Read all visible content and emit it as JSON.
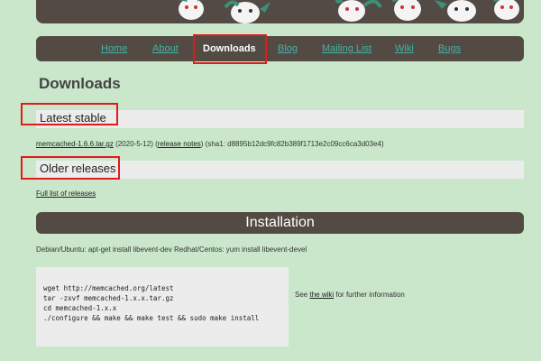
{
  "nav": {
    "items": [
      {
        "label": "Home"
      },
      {
        "label": "About"
      },
      {
        "label": "Downloads"
      },
      {
        "label": "Blog"
      },
      {
        "label": "Mailing List"
      },
      {
        "label": "Wiki"
      },
      {
        "label": "Bugs"
      }
    ],
    "active": "Downloads"
  },
  "page": {
    "title": "Downloads"
  },
  "latest": {
    "heading": "Latest stable",
    "file_link": "memcached-1.6.6.tar.gz",
    "date": "(2020-5-12)",
    "paren_open": " (",
    "notes_link": "release notes",
    "sha": ") (sha1: d8895b12dc9fc82b389f1713e2c09cc6ca3d03e4)"
  },
  "older": {
    "heading": "Older releases",
    "list_link": "Full list of releases"
  },
  "install": {
    "heading": "Installation",
    "pkg_text": "Debian/Ubuntu: apt-get install libevent-dev Redhat/Centos: yum install libevent-devel",
    "code_lines": [
      "wget http://memcached.org/latest",
      "tar -zxvf memcached-1.x.x.tar.gz",
      "cd memcached-1.x.x",
      "./configure && make && make test && sudo make install"
    ],
    "see_prefix": "See ",
    "wiki_link": "the wiki",
    "see_suffix": " for further information"
  },
  "colors": {
    "background": "#cae7cb",
    "bar": "#544a44",
    "nav_link": "#3fb4a6",
    "highlight": "#e11b1b",
    "section_bg": "#ececec"
  },
  "icons": [
    "mascot-illustration"
  ]
}
